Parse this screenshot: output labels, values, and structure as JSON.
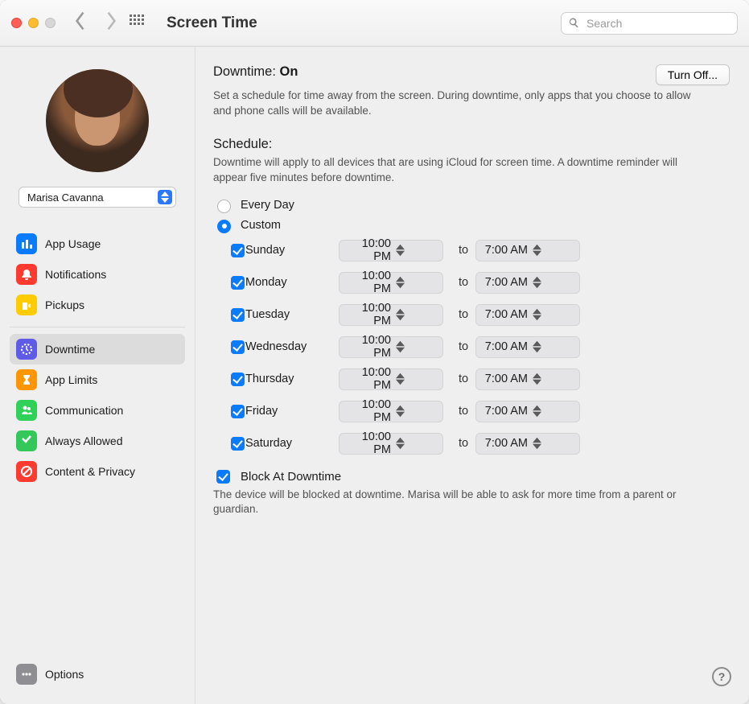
{
  "window": {
    "title": "Screen Time",
    "search_placeholder": "Search"
  },
  "user": {
    "selected_name": "Marisa Cavanna"
  },
  "sidebar": {
    "items": [
      {
        "id": "app-usage",
        "label": "App Usage",
        "colorClass": "ic-blue"
      },
      {
        "id": "notifications",
        "label": "Notifications",
        "colorClass": "ic-red"
      },
      {
        "id": "pickups",
        "label": "Pickups",
        "colorClass": "ic-yellow"
      },
      {
        "id": "downtime",
        "label": "Downtime",
        "colorClass": "ic-purple",
        "active": true
      },
      {
        "id": "app-limits",
        "label": "App Limits",
        "colorClass": "ic-orange"
      },
      {
        "id": "communication",
        "label": "Communication",
        "colorClass": "ic-green"
      },
      {
        "id": "always-allowed",
        "label": "Always Allowed",
        "colorClass": "ic-green2"
      },
      {
        "id": "content-privacy",
        "label": "Content & Privacy",
        "colorClass": "ic-red2"
      }
    ],
    "options_label": "Options"
  },
  "main": {
    "status_prefix": "Downtime: ",
    "status_value": "On",
    "turn_off_label": "Turn Off...",
    "downtime_description": "Set a schedule for time away from the screen. During downtime, only apps that you choose to allow and phone calls will be available.",
    "schedule_label": "Schedule:",
    "schedule_description": "Downtime will apply to all devices that are using iCloud for screen time. A downtime reminder will appear five minutes before downtime.",
    "schedule_mode": "custom",
    "every_day_label": "Every Day",
    "custom_label": "Custom",
    "to_label": "to",
    "days": [
      {
        "name": "Sunday",
        "enabled": true,
        "start": "10:00 PM",
        "end": "7:00 AM"
      },
      {
        "name": "Monday",
        "enabled": true,
        "start": "10:00 PM",
        "end": "7:00 AM"
      },
      {
        "name": "Tuesday",
        "enabled": true,
        "start": "10:00 PM",
        "end": "7:00 AM"
      },
      {
        "name": "Wednesday",
        "enabled": true,
        "start": "10:00 PM",
        "end": "7:00 AM"
      },
      {
        "name": "Thursday",
        "enabled": true,
        "start": "10:00 PM",
        "end": "7:00 AM"
      },
      {
        "name": "Friday",
        "enabled": true,
        "start": "10:00 PM",
        "end": "7:00 AM"
      },
      {
        "name": "Saturday",
        "enabled": true,
        "start": "10:00 PM",
        "end": "7:00 AM"
      }
    ],
    "block_label": "Block At Downtime",
    "block_enabled": true,
    "block_description": "The device will be blocked at downtime. Marisa will be able to ask for more time from a parent or guardian.",
    "help_label": "?"
  }
}
